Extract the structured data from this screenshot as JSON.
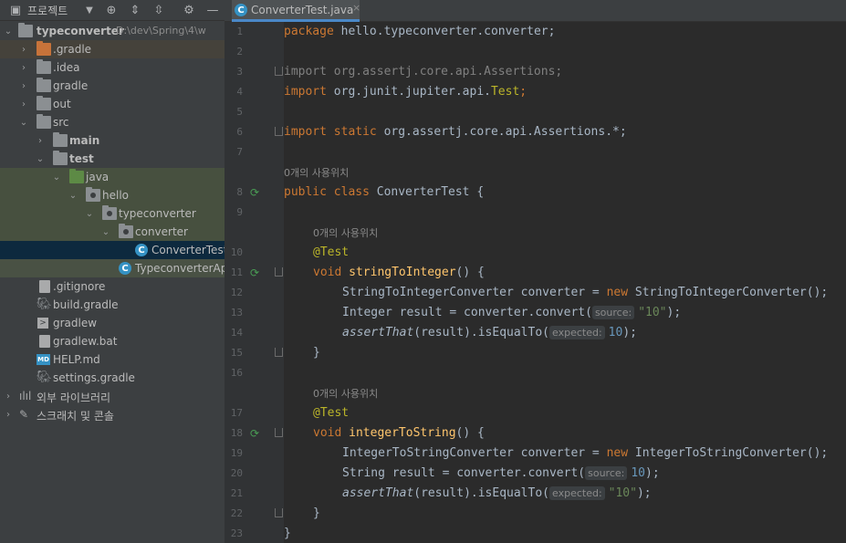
{
  "panel": {
    "title": "프로젝트"
  },
  "tree": {
    "root_label": "typeconverter",
    "root_path": "D:\\dev\\Spring\\4\\w",
    "items": [
      "typeconverter",
      ".gradle",
      ".idea",
      "gradle",
      "out",
      "src",
      "main",
      "test",
      "java",
      "hello",
      "typeconverter",
      "converter",
      "ConverterTest",
      "TypeconverterApp",
      ".gitignore",
      "build.gradle",
      "gradlew",
      "gradlew.bat",
      "HELP.md",
      "settings.gradle",
      "외부 라이브러리",
      "스크래치 및 콘솔"
    ]
  },
  "editor": {
    "tab_label": "ConverterTest.java",
    "tab_close": "×",
    "line_numbers": [
      "1",
      "2",
      "3",
      "4",
      "5",
      "6",
      "7",
      "8",
      "9",
      "10",
      "11",
      "12",
      "13",
      "14",
      "15",
      "16",
      "17",
      "18",
      "19",
      "20",
      "21",
      "22",
      "23"
    ],
    "usage_hint": "0개의 사용위치",
    "code": {
      "l1_kw": "package",
      "l1_rest": " hello.typeconverter.converter;",
      "l3": "import org.assertj.core.api.Assertions;",
      "l4_kw": "import",
      "l4_rest": " org.junit.jupiter.api.",
      "l4_cls": "Test",
      "l4_end": ";",
      "l6_kw": "import static",
      "l6_rest": " org.assertj.core.api.Assertions.*;",
      "l8_kw": "public class",
      "l8_rest": " ConverterTest {",
      "l10_ann": "@Test",
      "l11_kw": "void",
      "l11_fn": "stringToInteger",
      "l11_rest": "() {",
      "l12_a": "StringToIntegerConverter converter = ",
      "l12_kw": "new",
      "l12_b": " StringToIntegerConverter();",
      "l13_a": "Integer result = converter.convert(",
      "l13_hint": "source:",
      "l13_str": "\"10\"",
      "l13_b": ");",
      "l14_fn": "assertThat",
      "l14_a": "(result).isEqualTo(",
      "l14_hint": "expected:",
      "l14_num": "10",
      "l14_b": ");",
      "l15": "}",
      "l17_ann": "@Test",
      "l18_kw": "void",
      "l18_fn": "integerToString",
      "l18_rest": "() {",
      "l19_a": "IntegerToStringConverter converter = ",
      "l19_kw": "new",
      "l19_b": " IntegerToStringConverter();",
      "l20_a": "String result = converter.convert(",
      "l20_hint": "source:",
      "l20_num": "10",
      "l20_b": ");",
      "l21_fn": "assertThat",
      "l21_a": "(result).isEqualTo(",
      "l21_hint": "expected:",
      "l21_str": "\"10\"",
      "l21_b": ");",
      "l22": "}",
      "l23": "}"
    }
  },
  "colors": {
    "keyword": "#cc7832",
    "annotation": "#bbb529",
    "method": "#ffc66d",
    "number": "#6897bb",
    "string": "#6a8759",
    "selection": "#0d293e"
  }
}
